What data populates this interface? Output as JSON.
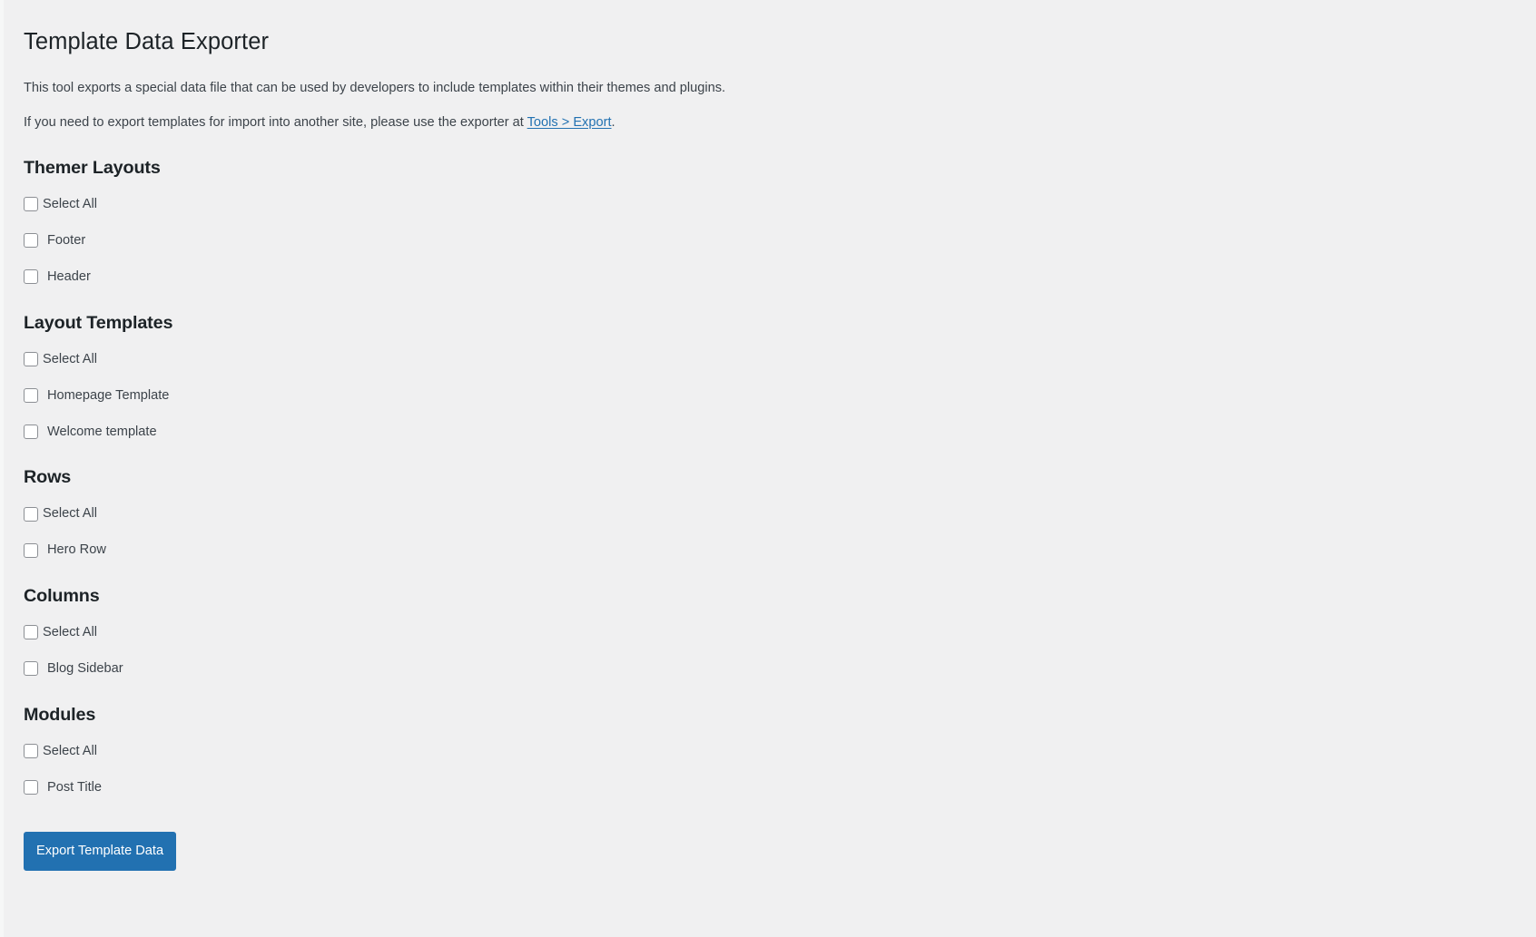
{
  "page": {
    "title": "Template Data Exporter",
    "intro_1": "This tool exports a special data file that can be used by developers to include templates within their themes and plugins.",
    "intro_2_before": "If you need to export templates for import into another site, please use the exporter at ",
    "intro_2_link": "Tools > Export",
    "intro_2_after": ".",
    "background_color": "#f0f0f1",
    "link_color": "#2271b1",
    "heading_color": "#1d2327",
    "text_color": "#3c434a"
  },
  "sections": [
    {
      "heading": "Themer Layouts",
      "select_all_label": "Select All",
      "items": [
        {
          "label": "Footer"
        },
        {
          "label": "Header"
        }
      ]
    },
    {
      "heading": "Layout Templates",
      "select_all_label": "Select All",
      "items": [
        {
          "label": "Homepage Template"
        },
        {
          "label": "Welcome template"
        }
      ]
    },
    {
      "heading": "Rows",
      "select_all_label": "Select All",
      "items": [
        {
          "label": "Hero Row"
        }
      ]
    },
    {
      "heading": "Columns",
      "select_all_label": "Select All",
      "items": [
        {
          "label": "Blog Sidebar"
        }
      ]
    },
    {
      "heading": "Modules",
      "select_all_label": "Select All",
      "items": [
        {
          "label": "Post Title"
        }
      ]
    }
  ],
  "submit": {
    "label": "Export Template Data",
    "color": "#2271b1"
  }
}
